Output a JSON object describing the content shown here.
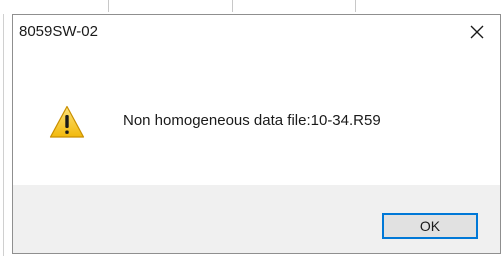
{
  "dialog": {
    "title": "8059SW-02",
    "message": "Non homogeneous data file:10-34.R59",
    "ok_label": "OK",
    "close_icon": "close-icon",
    "message_icon": "warning-icon"
  },
  "colors": {
    "accent": "#0078d7",
    "warning_fill": "#f9c514",
    "footer": "#f0f0f0"
  }
}
